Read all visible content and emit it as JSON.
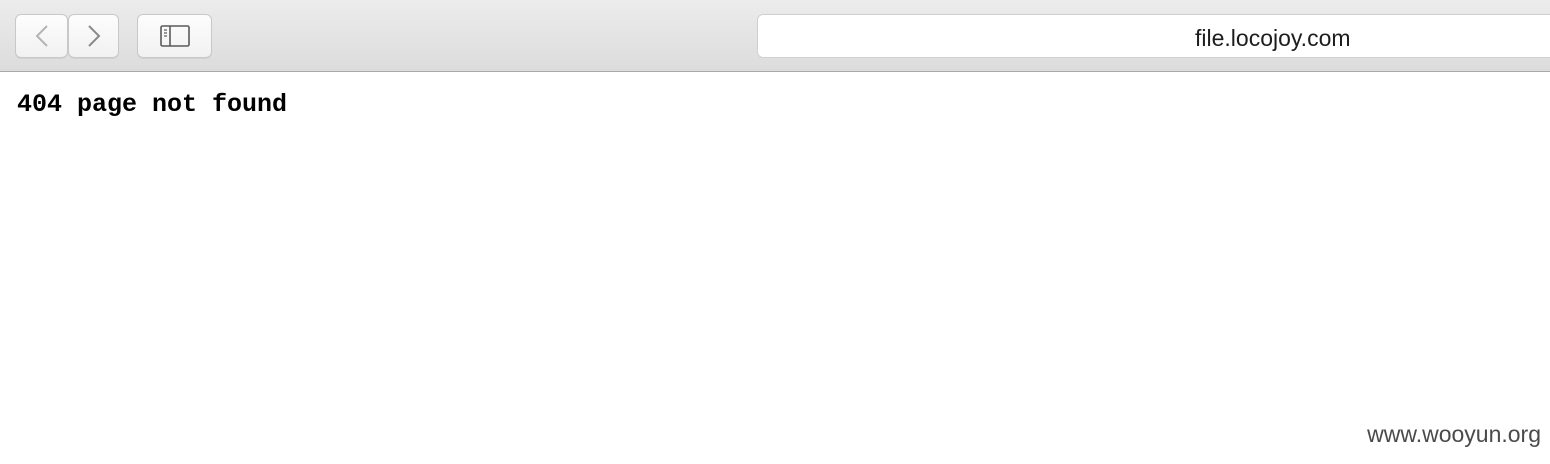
{
  "toolbar": {
    "back_icon": "chevron-left-icon",
    "forward_icon": "chevron-right-icon",
    "sidebar_icon": "sidebar-icon"
  },
  "address_bar": {
    "url": "file.locojoy.com"
  },
  "page": {
    "body_text": "404 page not found"
  },
  "watermark": {
    "text": "www.wooyun.org"
  }
}
